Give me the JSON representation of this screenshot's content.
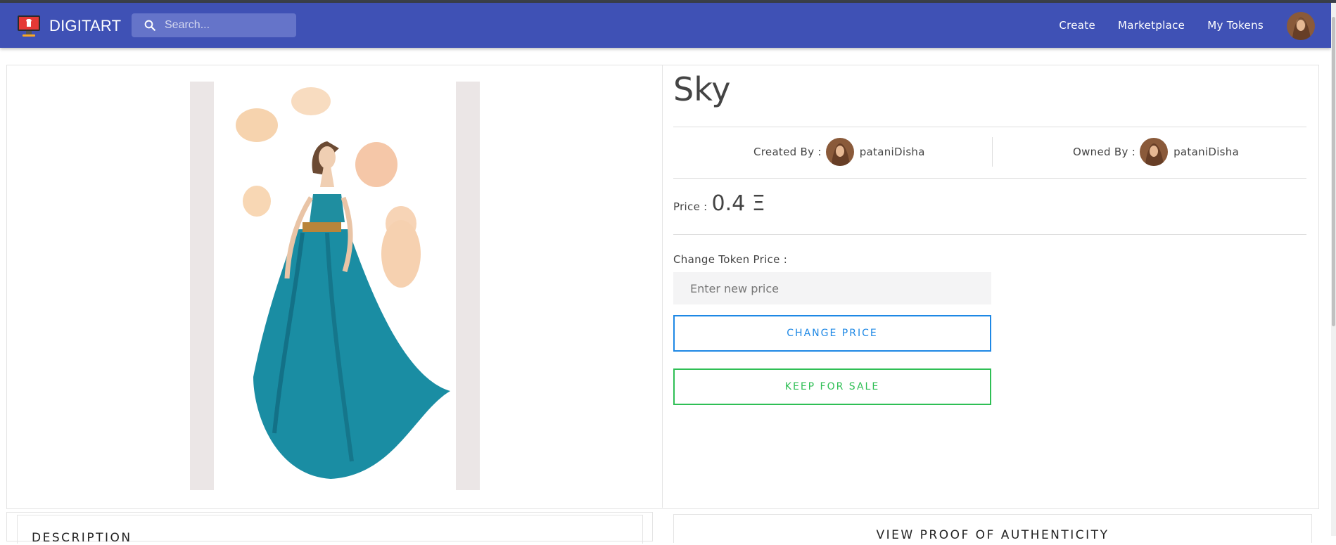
{
  "navbar": {
    "brand": "DIGITART",
    "search_placeholder": "Search...",
    "links": [
      "Create",
      "Marketplace",
      "My Tokens"
    ]
  },
  "token": {
    "title": "Sky",
    "created_by_label": "Created By :",
    "creator": "pataniDisha",
    "owned_by_label": "Owned By :",
    "owner": "pataniDisha",
    "price_label": "Price :",
    "price": "0.4 Ξ",
    "change_price_label": "Change Token Price :",
    "new_price_placeholder": "Enter new price",
    "change_price_button": "CHANGE PRICE",
    "keep_for_sale_button": "KEEP FOR SALE"
  },
  "panels": {
    "description_title": "DESCRIPTION",
    "proof_title": "VIEW PROOF OF AUTHENTICITY"
  },
  "colors": {
    "navbar": "#3f51b5",
    "change_price": "#1e88e5",
    "keep_for_sale": "#2fbf55"
  }
}
